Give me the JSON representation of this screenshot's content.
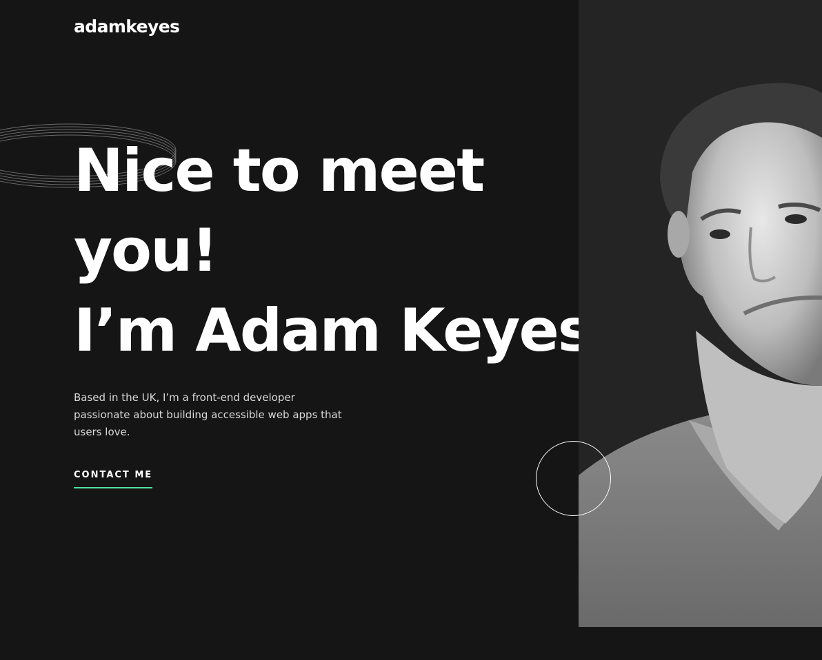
{
  "header": {
    "logo": "adamkeyes"
  },
  "hero": {
    "headline_line1": "Nice to meet",
    "headline_line2": "you!",
    "headline_prefix": "I’m ",
    "headline_name": "Adam Keyes",
    "headline_suffix": ".",
    "intro": "Based in the UK, I’m a front-end developer passionate about building accessible web apps that users love.",
    "cta_label": "CONTACT ME"
  },
  "colors": {
    "background": "#151515",
    "panel": "#242424",
    "accent": "#4ee1a0",
    "text": "#ffffff",
    "muted_text": "#d9d9d9"
  },
  "icons": {
    "rings": "rings-decoration",
    "circle": "circle-outline-decoration",
    "portrait": "profile-portrait-image"
  }
}
